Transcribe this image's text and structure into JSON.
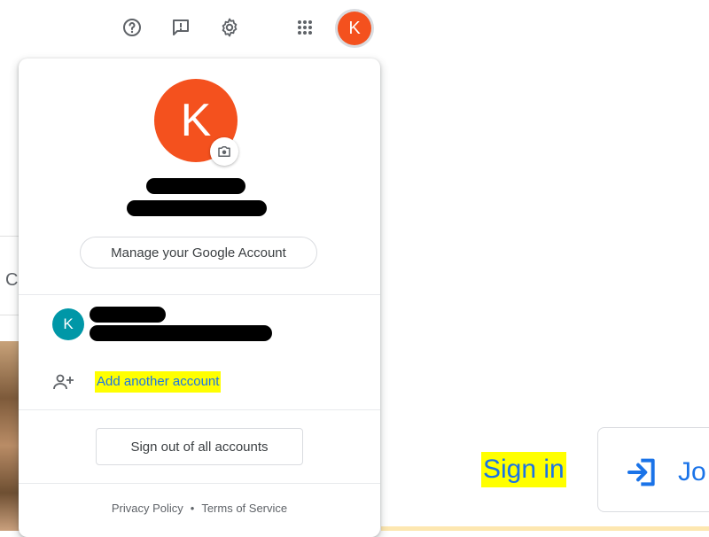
{
  "topbar": {
    "help_icon": "help-circle-icon",
    "feedback_icon": "feedback-icon",
    "settings_icon": "gear-icon",
    "apps_icon": "apps-grid-icon",
    "avatar_initial": "K"
  },
  "panel": {
    "avatar_initial": "K",
    "manage_label": "Manage your Google Account",
    "account_avatar_initial": "K",
    "add_account_label": "Add another account",
    "signout_label": "Sign out of all accounts",
    "privacy_label": "Privacy Policy",
    "separator": "•",
    "terms_label": "Terms of Service"
  },
  "page": {
    "signin_label": "Sign in",
    "join_label": "Jo"
  },
  "colors": {
    "avatar_orange": "#f4511e",
    "avatar_teal": "#0097a7",
    "link_blue": "#1a73e8",
    "highlight": "#ffff00"
  }
}
